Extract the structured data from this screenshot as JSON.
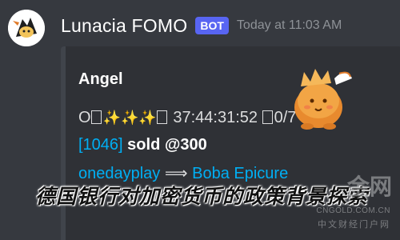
{
  "message": {
    "username": "Lunacia FOMO",
    "badge": "BOT",
    "timestamp": "Today at 11:03 AM"
  },
  "embed": {
    "title": "Angel",
    "reminder_prefix": "O",
    "sparkles": "✨✨✨",
    "countdown": "37:44:31:52",
    "count": "0/7",
    "id_label": "[1046]",
    "sold_label": "sold",
    "price": "@300",
    "seller": "onedayplay",
    "arrow": "⟹",
    "buyer": "Boba Epicure"
  },
  "overlay": {
    "title": "德国银行对加密货币的政策背景探索"
  },
  "watermark": {
    "brand": "金网",
    "url": "CNGOLD.COM.CN",
    "cn": "中文财经门户网"
  },
  "colors": {
    "background": "#36393f",
    "embed_bg": "#2f3136",
    "bot_badge": "#5865f2",
    "link": "#00aff4",
    "sparkle": "#f8c936"
  },
  "icons": {
    "avatar": "character-avatar-icon",
    "thumbnail": "angel-creature-thumbnail"
  }
}
